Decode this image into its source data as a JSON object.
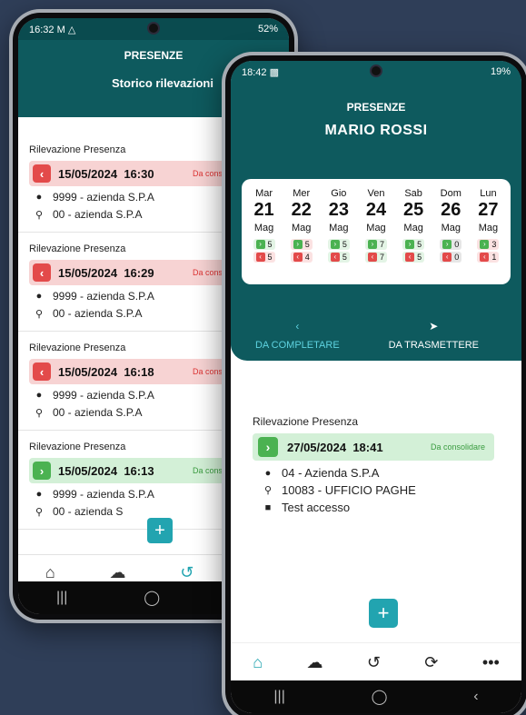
{
  "phone_back": {
    "status": {
      "time": "16:32",
      "left_icons": "M △",
      "right": "52%"
    },
    "header": {
      "title": "PRESENZE",
      "subtitle": "Storico rilevazioni"
    },
    "records": [
      {
        "label": "Rilevazione Presenza",
        "date": "15/05/2024",
        "time": "16:30",
        "state": "out",
        "badge": "Da consol",
        "company": "9999 -  azienda S.P.A",
        "office": "00 -  azienda S.P.A"
      },
      {
        "label": "Rilevazione Presenza",
        "date": "15/05/2024",
        "time": "16:29",
        "state": "out",
        "badge": "Da conso",
        "company": "9999 -  azienda S.P.A",
        "office": "00 -  azienda S.P.A"
      },
      {
        "label": "Rilevazione Presenza",
        "date": "15/05/2024",
        "time": "16:18",
        "state": "out",
        "badge": "Da conso",
        "company": "9999 -  azienda S.P.A",
        "office": "00 -  azienda S.P.A"
      },
      {
        "label": "Rilevazione Presenza",
        "date": "15/05/2024",
        "time": "16:13",
        "state": "in",
        "badge": "Da conso",
        "company": "9999 -  azienda S.P.A",
        "office": "00 -  azienda S"
      }
    ],
    "icons": {
      "home": "home-icon",
      "upload": "cloud-upload-icon",
      "history": "history-icon",
      "sync": "sync-icon"
    }
  },
  "phone_front": {
    "status": {
      "time": "18:42",
      "right": "19%"
    },
    "header": {
      "title": "PRESENZE",
      "name": "MARIO ROSSI"
    },
    "calendar": [
      {
        "dow": "Mar",
        "day": "21",
        "month": "Mag",
        "in": "5",
        "out": "5",
        "state": "normal"
      },
      {
        "dow": "Mer",
        "day": "22",
        "month": "Mag",
        "in": "5",
        "out": "4",
        "state": "warn"
      },
      {
        "dow": "Gio",
        "day": "23",
        "month": "Mag",
        "in": "5",
        "out": "5",
        "state": "normal"
      },
      {
        "dow": "Ven",
        "day": "24",
        "month": "Mag",
        "in": "7",
        "out": "7",
        "state": "normal"
      },
      {
        "dow": "Sab",
        "day": "25",
        "month": "Mag",
        "in": "5",
        "out": "5",
        "state": "normal"
      },
      {
        "dow": "Dom",
        "day": "26",
        "month": "Mag",
        "in": "0",
        "out": "0",
        "state": "empty"
      },
      {
        "dow": "Lun",
        "day": "27",
        "month": "Mag",
        "in": "3",
        "out": "1",
        "state": "warn"
      }
    ],
    "tabs": {
      "complete": "DA COMPLETARE",
      "transmit": "DA TRASMETTERE"
    },
    "record": {
      "label": "Rilevazione Presenza",
      "date": "27/05/2024",
      "time": "18:41",
      "badge": "Da consolidare",
      "company": "04 - Azienda S.P.A",
      "office": "10083 - UFFICIO PAGHE",
      "note": "Test accesso"
    }
  },
  "colors": {
    "header_teal": "#0e5a5e",
    "accent": "#22a4b0",
    "in_green": "#4bb251",
    "out_red": "#e34a4a"
  }
}
